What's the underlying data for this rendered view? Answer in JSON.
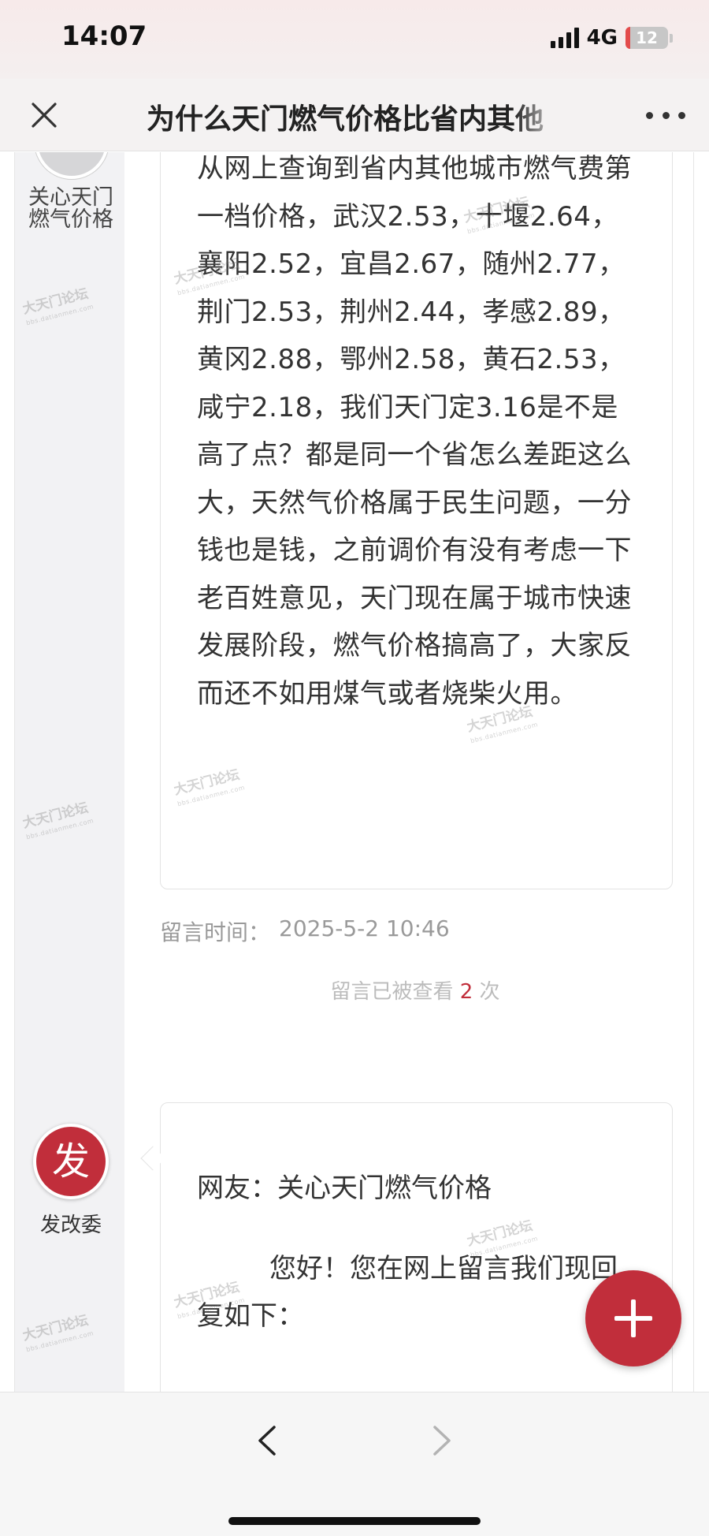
{
  "status_bar": {
    "time": "14:07",
    "network": "4G",
    "battery": "12",
    "battery_level": 0.12
  },
  "nav": {
    "title": "为什么天门燃气价格比省内其他",
    "close_icon": "close-icon",
    "more_icon": "more-icon"
  },
  "message": {
    "author": "关心天门燃气价格",
    "content": "从网上查询到省内其他城市燃气费第一档价格，武汉2.53，十堰2.64，襄阳2.52，宜昌2.67，随州2.77，荆门2.53，荆州2.44，孝感2.89，黄冈2.88，鄂州2.58，黄石2.53，咸宁2.18，我们天门定3.16是不是高了点？都是同一个省怎么差距这么大，天然气价格属于民生问题，一分钱也是钱，之前调价有没有考虑一下老百姓意见，天门现在属于城市快速发展阶段，燃气价格搞高了，大家反而还不如用煤气或者烧柴火用。",
    "time_label": "留言时间：",
    "time_value": "2025-5-2 10:46",
    "views_prefix": "留言已被查看",
    "views_count": "2",
    "views_suffix": "次"
  },
  "reply": {
    "avatar_char": "发",
    "responder": "发改委",
    "to_label": "网友：",
    "to_name": "关心天门燃气价格",
    "body": "您好！您在网上留言我们现回复如下："
  },
  "watermark": {
    "text": "大天门论坛",
    "sub": "bbs.datianmen.com"
  },
  "colors": {
    "accent": "#c12e3b",
    "muted": "#9a9a9a"
  },
  "toolbar": {
    "back_icon": "chevron-left-icon",
    "forward_icon": "chevron-right-icon",
    "fab_icon": "plus-icon"
  }
}
